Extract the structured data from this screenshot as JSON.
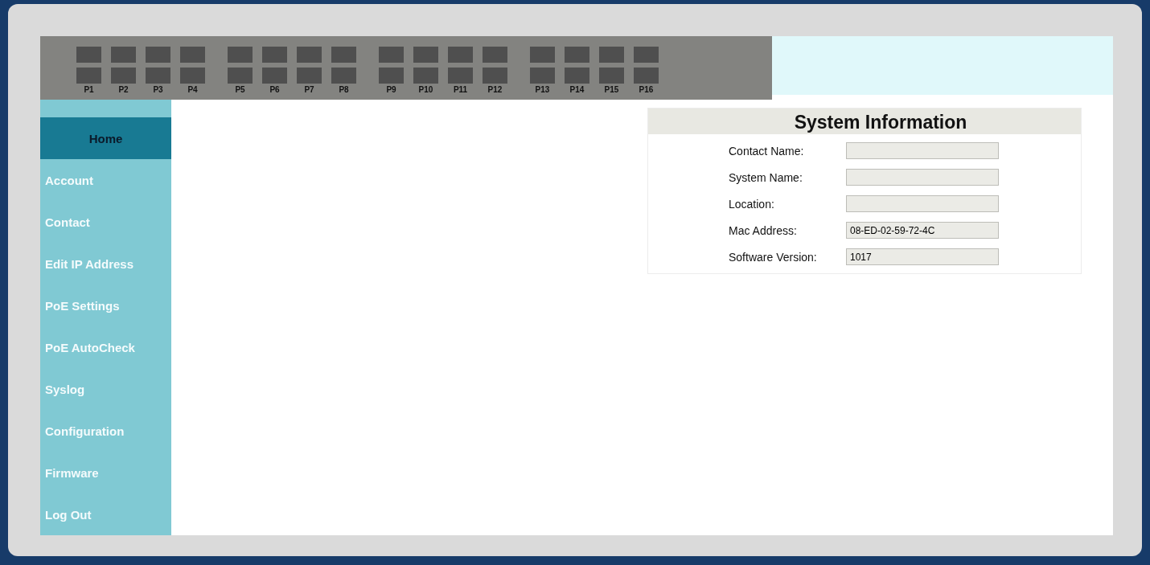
{
  "ports": [
    {
      "label": "P1"
    },
    {
      "label": "P2"
    },
    {
      "label": "P3"
    },
    {
      "label": "P4"
    },
    {
      "label": "P5"
    },
    {
      "label": "P6"
    },
    {
      "label": "P7"
    },
    {
      "label": "P8"
    },
    {
      "label": "P9"
    },
    {
      "label": "P10"
    },
    {
      "label": "P11"
    },
    {
      "label": "P12"
    },
    {
      "label": "P13"
    },
    {
      "label": "P14"
    },
    {
      "label": "P15"
    },
    {
      "label": "P16"
    }
  ],
  "sidebar": {
    "items": [
      {
        "label": "Home",
        "selected": true
      },
      {
        "label": "Account",
        "selected": false
      },
      {
        "label": "Contact",
        "selected": false
      },
      {
        "label": "Edit IP Address",
        "selected": false
      },
      {
        "label": "PoE Settings",
        "selected": false
      },
      {
        "label": "PoE AutoCheck",
        "selected": false
      },
      {
        "label": "Syslog",
        "selected": false
      },
      {
        "label": "Configuration",
        "selected": false
      },
      {
        "label": "Firmware",
        "selected": false
      },
      {
        "label": "Log Out",
        "selected": false
      }
    ]
  },
  "system_information": {
    "title": "System Information",
    "fields": [
      {
        "label": "Contact Name:"
      },
      {
        "label": "System Name:"
      },
      {
        "label": "Location:"
      },
      {
        "label": "Mac Address:",
        "value": "08-ED-02-59-72-4C"
      },
      {
        "label": "Software Version:",
        "value": "1017"
      }
    ]
  }
}
